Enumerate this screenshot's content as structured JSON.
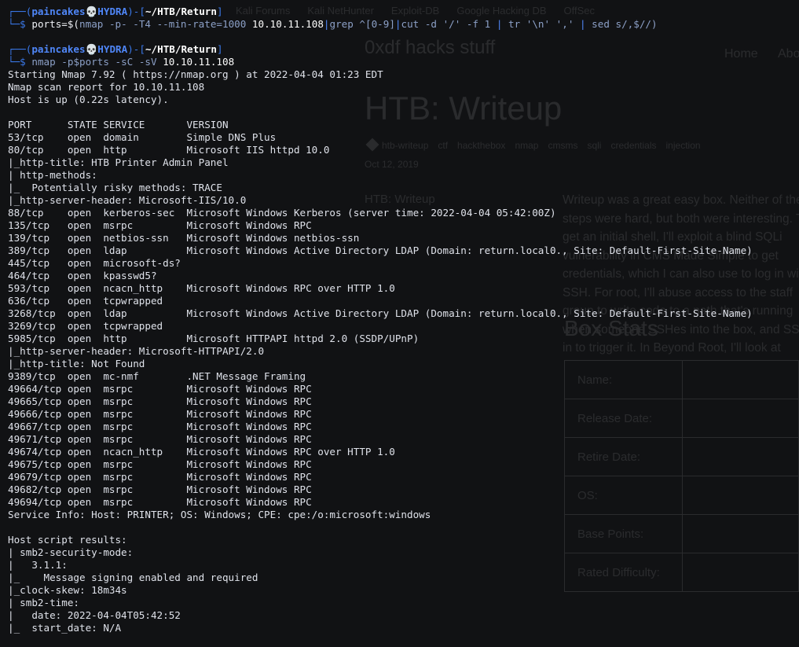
{
  "browser": {
    "bookmarks": [
      "Kali Forums",
      "Kali NetHunter",
      "Exploit-DB",
      "Google Hacking DB",
      "OffSec"
    ],
    "site_title": "0xdf hacks stuff",
    "nav": [
      "Home",
      "About"
    ],
    "page_title": "HTB: Writeup",
    "tags": [
      "htb-writeup",
      "ctf",
      "hackthebox",
      "nmap",
      "cmsms",
      "sqli",
      "credentials",
      "injection"
    ],
    "date": "Oct 12, 2019",
    "toc": "HTB: Writeup",
    "intro": "Writeup was a great easy box. Neither of the steps were hard, but both were interesting. To get an initial shell, I'll exploit a blind SQLi vulnerability in CMS Made Simple to get credentials, which I can also use to log in with SSH. For root, I'll abuse access to the staff group to write code to a path that's running when someone SSHes into the box, and SSH in to trigger it. In Beyond Root, I'll look at",
    "stats_heading": "Box Stats",
    "stats_rows": [
      "Name:",
      "Release Date:",
      "Retire Date:",
      "OS:",
      "Base Points:",
      "Rated Difficulty:"
    ]
  },
  "terminal": {
    "prompt": {
      "user": "paincakes",
      "host": "HYDRA",
      "skull": "💀",
      "path": "~/HTB/Return",
      "dollar": "$"
    },
    "cmd1": {
      "a": "ports=$(",
      "b": "nmap -p- -T4 --min-rate=1000",
      "c": " 10.10.11.108",
      "d": "|",
      "e": "grep ^[0-9]",
      "f": "|",
      "g": "cut -d '/' -f 1",
      "h": " | ",
      "i": "tr '\\n' ','",
      "j": " | ",
      "k": "sed s/,$//)"
    },
    "cmd2": {
      "a": "nmap -p",
      "b": "$ports",
      "c": " -sC -sV",
      "d": " 10.10.11.108"
    },
    "output": [
      "Starting Nmap 7.92 ( https://nmap.org ) at 2022-04-04 01:23 EDT",
      "Nmap scan report for 10.10.11.108",
      "Host is up (0.22s latency).",
      "",
      "PORT      STATE SERVICE       VERSION",
      "53/tcp    open  domain        Simple DNS Plus",
      "80/tcp    open  http          Microsoft IIS httpd 10.0",
      "|_http-title: HTB Printer Admin Panel",
      "| http-methods:",
      "|_  Potentially risky methods: TRACE",
      "|_http-server-header: Microsoft-IIS/10.0",
      "88/tcp    open  kerberos-sec  Microsoft Windows Kerberos (server time: 2022-04-04 05:42:00Z)",
      "135/tcp   open  msrpc         Microsoft Windows RPC",
      "139/tcp   open  netbios-ssn   Microsoft Windows netbios-ssn",
      "389/tcp   open  ldap          Microsoft Windows Active Directory LDAP (Domain: return.local0., Site: Default-First-Site-Name)",
      "445/tcp   open  microsoft-ds?",
      "464/tcp   open  kpasswd5?",
      "593/tcp   open  ncacn_http    Microsoft Windows RPC over HTTP 1.0",
      "636/tcp   open  tcpwrapped",
      "3268/tcp  open  ldap          Microsoft Windows Active Directory LDAP (Domain: return.local0., Site: Default-First-Site-Name)",
      "3269/tcp  open  tcpwrapped",
      "5985/tcp  open  http          Microsoft HTTPAPI httpd 2.0 (SSDP/UPnP)",
      "|_http-server-header: Microsoft-HTTPAPI/2.0",
      "|_http-title: Not Found",
      "9389/tcp  open  mc-nmf        .NET Message Framing",
      "49664/tcp open  msrpc         Microsoft Windows RPC",
      "49665/tcp open  msrpc         Microsoft Windows RPC",
      "49666/tcp open  msrpc         Microsoft Windows RPC",
      "49667/tcp open  msrpc         Microsoft Windows RPC",
      "49671/tcp open  msrpc         Microsoft Windows RPC",
      "49674/tcp open  ncacn_http    Microsoft Windows RPC over HTTP 1.0",
      "49675/tcp open  msrpc         Microsoft Windows RPC",
      "49679/tcp open  msrpc         Microsoft Windows RPC",
      "49682/tcp open  msrpc         Microsoft Windows RPC",
      "49694/tcp open  msrpc         Microsoft Windows RPC",
      "Service Info: Host: PRINTER; OS: Windows; CPE: cpe:/o:microsoft:windows",
      "",
      "Host script results:",
      "| smb2-security-mode:",
      "|   3.1.1:",
      "|_    Message signing enabled and required",
      "|_clock-skew: 18m34s",
      "| smb2-time:",
      "|   date: 2022-04-04T05:42:52",
      "|_  start_date: N/A"
    ]
  }
}
